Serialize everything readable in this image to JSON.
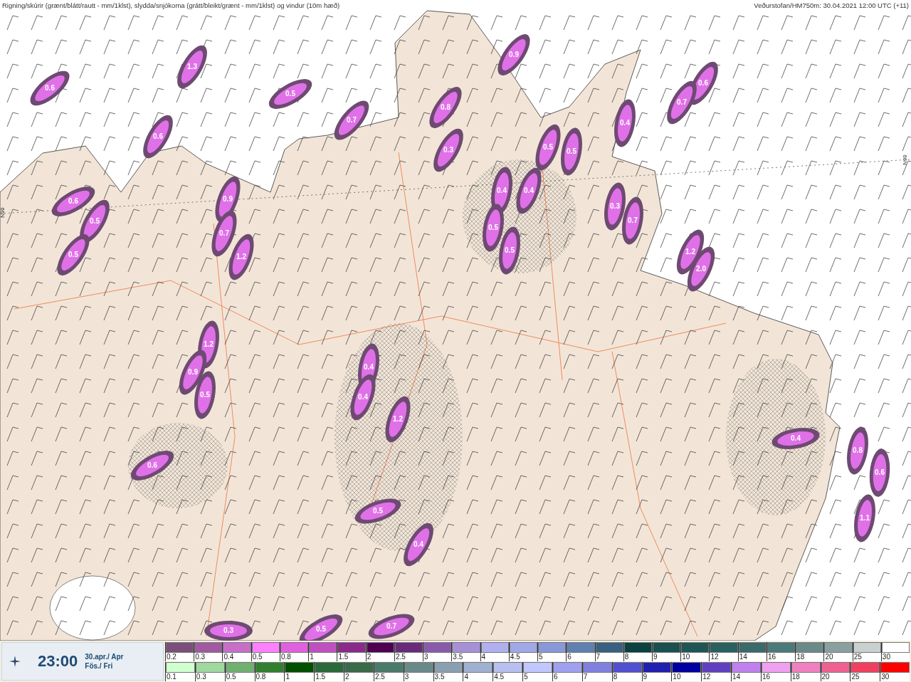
{
  "header": {
    "title": "Rigning/skúrir (grænt/blátt/rautt - mm/1klst), slydda/snjókoma (grátt/bleikt/grænt - mm/1klst) og vindur (10m hæð)",
    "source": "Veðurstofan/HM750m: 30.04.2021 12:00 UTC (+11)"
  },
  "map": {
    "latitude_labels": [
      "66N",
      "66N"
    ],
    "precip_labels": [
      "0.6",
      "1.3",
      "0.6",
      "0.5",
      "0.7",
      "0.8",
      "0.3",
      "0.9",
      "0.6",
      "0.7",
      "0.4",
      "0.5",
      "0.5",
      "0.4",
      "0.4",
      "0.3",
      "0.7",
      "0.5",
      "0.5",
      "1.2",
      "2.0",
      "0.6",
      "0.5",
      "0.5",
      "0.9",
      "0.7",
      "1.2",
      "1.2",
      "0.9",
      "0.5",
      "0.4",
      "0.4",
      "1.2",
      "0.6",
      "0.5",
      "0.4",
      "0.3",
      "0.5",
      "0.7",
      "0.4",
      "0.8",
      "0.6",
      "1.1"
    ]
  },
  "time_box": {
    "time": "23:00",
    "date": "30.apr./ Apr",
    "weekday": "Fös./ Fri"
  },
  "legend_snow": [
    {
      "label": "0.2",
      "color": "#7a4f7a"
    },
    {
      "label": "0.3",
      "color": "#a05aa0"
    },
    {
      "label": "0.4",
      "color": "#c86ec8"
    },
    {
      "label": "0.5",
      "color": "#ff80ff"
    },
    {
      "label": "0.8",
      "color": "#e060e0"
    },
    {
      "label": "1",
      "color": "#c050c0"
    },
    {
      "label": "1.5",
      "color": "#8a2a8a"
    },
    {
      "label": "2",
      "color": "#500050"
    },
    {
      "label": "2.5",
      "color": "#6a2a7a"
    },
    {
      "label": "3",
      "color": "#8a5aaa"
    },
    {
      "label": "3.5",
      "color": "#a890d8"
    },
    {
      "label": "4",
      "color": "#b0b0f0"
    },
    {
      "label": "4.5",
      "color": "#a0a8e8"
    },
    {
      "label": "5",
      "color": "#8898d8"
    },
    {
      "label": "6",
      "color": "#6080b0"
    },
    {
      "label": "7",
      "color": "#3a6080"
    },
    {
      "label": "8",
      "color": "#0a4040"
    },
    {
      "label": "9",
      "color": "#1a5050"
    },
    {
      "label": "10",
      "color": "#1f5555"
    },
    {
      "label": "12",
      "color": "#2a6060"
    },
    {
      "label": "14",
      "color": "#3a6a6a"
    },
    {
      "label": "16",
      "color": "#4a7a7a"
    },
    {
      "label": "18",
      "color": "#6a8a8a"
    },
    {
      "label": "20",
      "color": "#8aa0a0"
    },
    {
      "label": "25",
      "color": "#c8d0d0"
    },
    {
      "label": "30",
      "color": "#ffffff"
    }
  ],
  "legend_rain": [
    {
      "label": "0.1",
      "color": "#d0ffd0"
    },
    {
      "label": "0.3",
      "color": "#a0d8a0"
    },
    {
      "label": "0.5",
      "color": "#70b070"
    },
    {
      "label": "0.8",
      "color": "#308030"
    },
    {
      "label": "1",
      "color": "#005000"
    },
    {
      "label": "1.5",
      "color": "#2a6a3a"
    },
    {
      "label": "2",
      "color": "#3a6a4a"
    },
    {
      "label": "2.5",
      "color": "#4a7a6a"
    },
    {
      "label": "3",
      "color": "#6a8a8a"
    },
    {
      "label": "3.5",
      "color": "#8aa0b0"
    },
    {
      "label": "4",
      "color": "#a0b0d0"
    },
    {
      "label": "4.5",
      "color": "#b8c0f0"
    },
    {
      "label": "5",
      "color": "#c0c8ff"
    },
    {
      "label": "6",
      "color": "#a0a0f0"
    },
    {
      "label": "7",
      "color": "#8080e0"
    },
    {
      "label": "8",
      "color": "#5050d0"
    },
    {
      "label": "9",
      "color": "#2020b0"
    },
    {
      "label": "10",
      "color": "#0000a0"
    },
    {
      "label": "12",
      "color": "#6040c0"
    },
    {
      "label": "14",
      "color": "#c080f0"
    },
    {
      "label": "16",
      "color": "#f0a0f0"
    },
    {
      "label": "18",
      "color": "#f080c0"
    },
    {
      "label": "20",
      "color": "#f06090"
    },
    {
      "label": "25",
      "color": "#f04060"
    },
    {
      "label": "30",
      "color": "#ff0000"
    }
  ]
}
